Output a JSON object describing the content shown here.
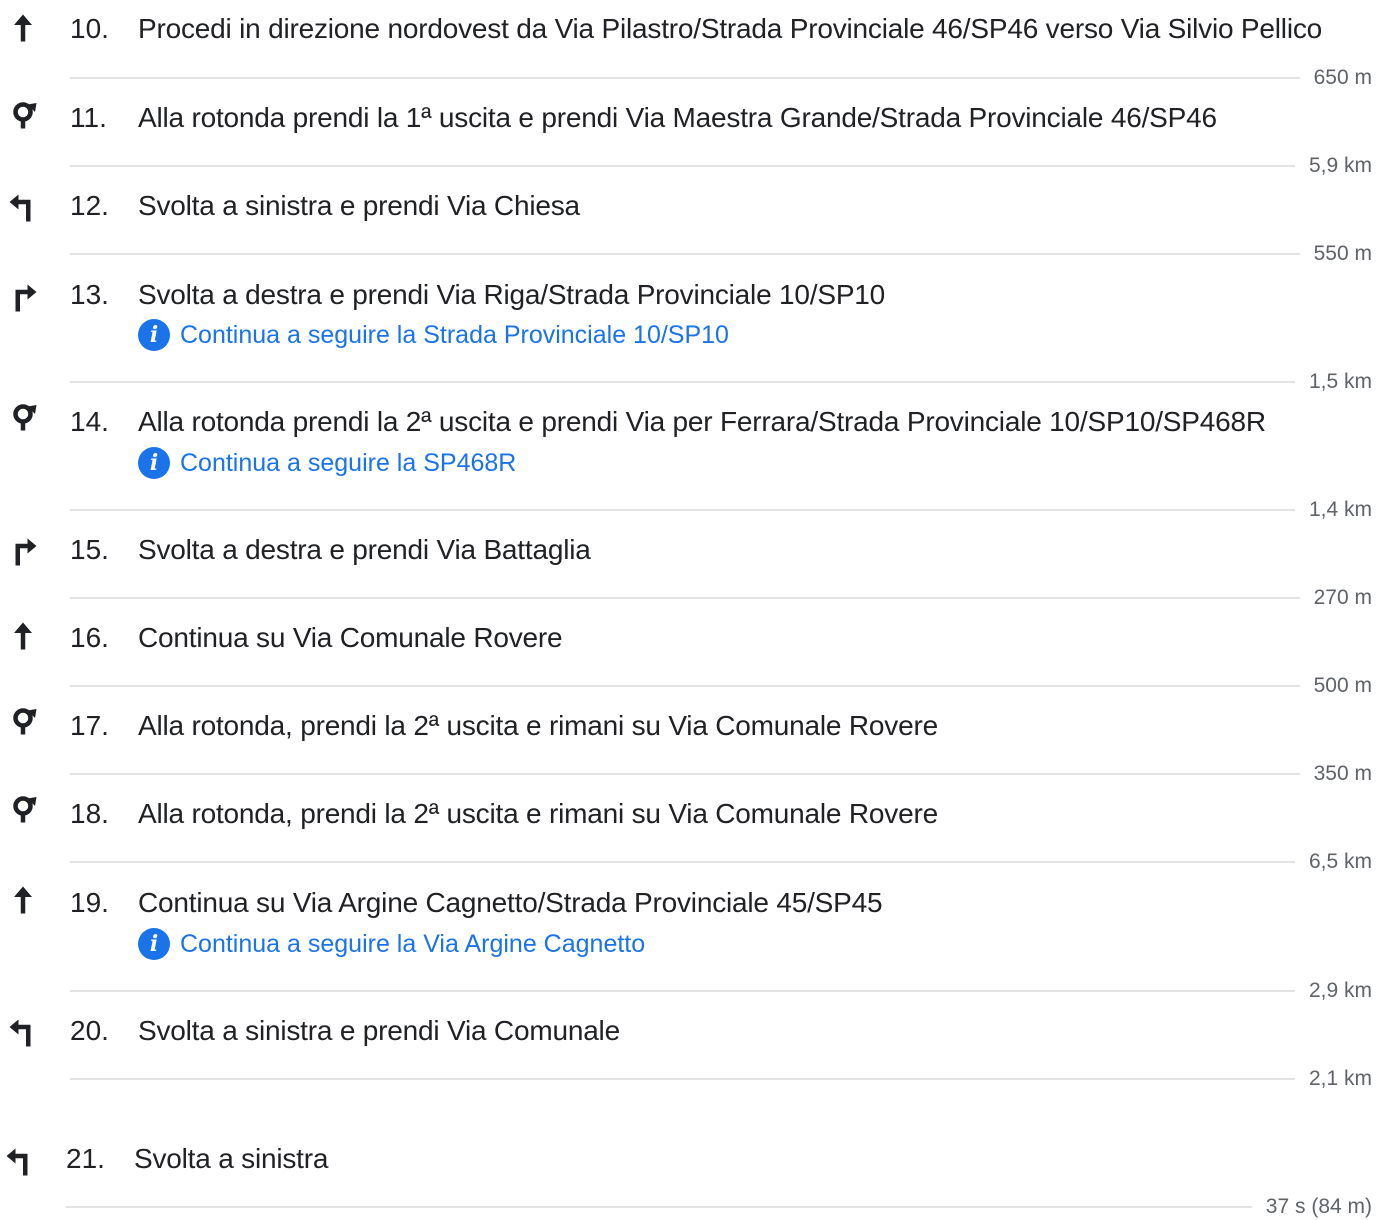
{
  "route": {
    "steps": [
      {
        "number": "10.",
        "icon": "straight-arrow-icon",
        "text": "Procedi in direzione nordovest da Via Pilastro/Strada Provinciale 46/SP46 verso Via Silvio Pellico",
        "distance": "650 m"
      },
      {
        "number": "11.",
        "icon": "roundabout-icon",
        "text": "Alla rotonda prendi la 1ª uscita e prendi Via Maestra Grande/Strada Provinciale 46/SP46",
        "distance": "5,9 km"
      },
      {
        "number": "12.",
        "icon": "turn-left-icon",
        "text": "Svolta a sinistra e prendi Via Chiesa",
        "distance": "550 m"
      },
      {
        "number": "13.",
        "icon": "turn-right-icon",
        "text": "Svolta a destra e prendi Via Riga/Strada Provinciale 10/SP10",
        "note": "Continua a seguire la Strada Provinciale 10/SP10",
        "distance": "1,5 km"
      },
      {
        "number": "14.",
        "icon": "roundabout-icon",
        "text": "Alla rotonda prendi la 2ª uscita e prendi Via per Ferrara/Strada Provinciale 10/SP10/SP468R",
        "note": "Continua a seguire la SP468R",
        "distance": "1,4 km"
      },
      {
        "number": "15.",
        "icon": "turn-right-icon",
        "text": "Svolta a destra e prendi Via Battaglia",
        "distance": "270 m"
      },
      {
        "number": "16.",
        "icon": "straight-arrow-icon",
        "text": "Continua su Via Comunale Rovere",
        "distance": "500 m"
      },
      {
        "number": "17.",
        "icon": "roundabout-icon",
        "text": "Alla rotonda, prendi la 2ª uscita e rimani su Via Comunale Rovere",
        "distance": "350 m"
      },
      {
        "number": "18.",
        "icon": "roundabout-icon",
        "text": "Alla rotonda, prendi la 2ª uscita e rimani su Via Comunale Rovere",
        "distance": "6,5 km"
      },
      {
        "number": "19.",
        "icon": "straight-arrow-icon",
        "text": "Continua su Via Argine Cagnetto/Strada Provinciale 45/SP45",
        "note": "Continua a seguire la Via Argine Cagnetto",
        "distance": "2,9 km"
      },
      {
        "number": "20.",
        "icon": "turn-left-icon",
        "text": "Svolta a sinistra e prendi Via Comunale",
        "distance": "2,1 km"
      },
      {
        "number": "21.",
        "icon": "turn-left-icon",
        "text": "Svolta a sinistra",
        "distance": "37 s (84 m)"
      }
    ]
  },
  "colors": {
    "text": "#202124",
    "link": "#1a73e8",
    "muted": "#5f6368",
    "divider": "#e3e3e3"
  }
}
